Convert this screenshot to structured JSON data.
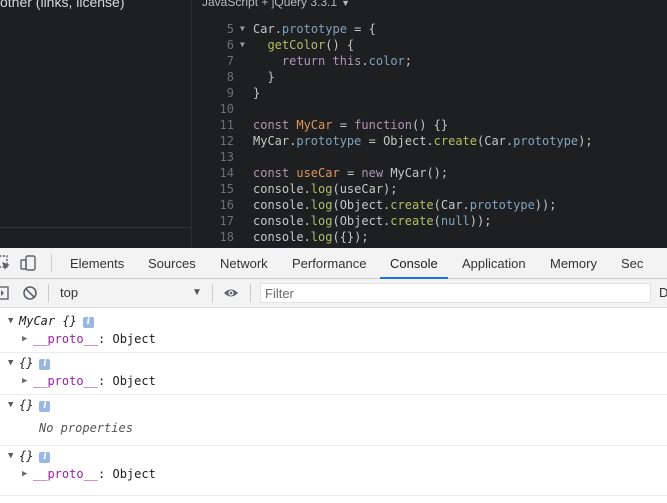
{
  "left_panel": {
    "text": "other (links, license)"
  },
  "editor": {
    "framework": "JavaScript + jQuery 3.3.1",
    "lines": [
      {
        "n": "5",
        "fold": true,
        "tokens": [
          {
            "t": "Car",
            "c": "p"
          },
          {
            "t": ".",
            "c": "p"
          },
          {
            "t": "prototype",
            "c": "prop"
          },
          {
            "t": " = {",
            "c": "p"
          }
        ]
      },
      {
        "n": "6",
        "fold": true,
        "tokens": [
          {
            "t": "  ",
            "c": "p"
          },
          {
            "t": "getColor",
            "c": "fn"
          },
          {
            "t": "() {",
            "c": "p"
          }
        ]
      },
      {
        "n": "7",
        "fold": false,
        "tokens": [
          {
            "t": "    ",
            "c": "p"
          },
          {
            "t": "return",
            "c": "kw"
          },
          {
            "t": " ",
            "c": "p"
          },
          {
            "t": "this",
            "c": "kw"
          },
          {
            "t": ".",
            "c": "p"
          },
          {
            "t": "color",
            "c": "prop"
          },
          {
            "t": ";",
            "c": "p"
          }
        ]
      },
      {
        "n": "8",
        "fold": false,
        "tokens": [
          {
            "t": "  }",
            "c": "p"
          }
        ]
      },
      {
        "n": "9",
        "fold": false,
        "tokens": [
          {
            "t": "}",
            "c": "p"
          }
        ]
      },
      {
        "n": "10",
        "fold": false,
        "tokens": []
      },
      {
        "n": "11",
        "fold": false,
        "tokens": [
          {
            "t": "const",
            "c": "kw"
          },
          {
            "t": " ",
            "c": "p"
          },
          {
            "t": "MyCar",
            "c": "var"
          },
          {
            "t": " = ",
            "c": "p"
          },
          {
            "t": "function",
            "c": "kw"
          },
          {
            "t": "() {}",
            "c": "p"
          }
        ]
      },
      {
        "n": "12",
        "fold": false,
        "tokens": [
          {
            "t": "MyCar.",
            "c": "p"
          },
          {
            "t": "prototype",
            "c": "prop"
          },
          {
            "t": " = Object.",
            "c": "p"
          },
          {
            "t": "create",
            "c": "fn"
          },
          {
            "t": "(Car.",
            "c": "p"
          },
          {
            "t": "prototype",
            "c": "prop"
          },
          {
            "t": ");",
            "c": "p"
          }
        ]
      },
      {
        "n": "13",
        "fold": false,
        "tokens": []
      },
      {
        "n": "14",
        "fold": false,
        "tokens": [
          {
            "t": "const",
            "c": "kw"
          },
          {
            "t": " ",
            "c": "p"
          },
          {
            "t": "useCar",
            "c": "var"
          },
          {
            "t": " = ",
            "c": "p"
          },
          {
            "t": "new",
            "c": "kw"
          },
          {
            "t": " MyCar();",
            "c": "p"
          }
        ]
      },
      {
        "n": "15",
        "fold": false,
        "tokens": [
          {
            "t": "console.",
            "c": "p"
          },
          {
            "t": "log",
            "c": "fn"
          },
          {
            "t": "(useCar);",
            "c": "p"
          }
        ]
      },
      {
        "n": "16",
        "fold": false,
        "tokens": [
          {
            "t": "console.",
            "c": "p"
          },
          {
            "t": "log",
            "c": "fn"
          },
          {
            "t": "(Object.",
            "c": "p"
          },
          {
            "t": "create",
            "c": "fn"
          },
          {
            "t": "(Car.",
            "c": "p"
          },
          {
            "t": "prototype",
            "c": "prop"
          },
          {
            "t": "));",
            "c": "p"
          }
        ]
      },
      {
        "n": "17",
        "fold": false,
        "tokens": [
          {
            "t": "console.",
            "c": "p"
          },
          {
            "t": "log",
            "c": "fn"
          },
          {
            "t": "(Object.",
            "c": "p"
          },
          {
            "t": "create",
            "c": "fn"
          },
          {
            "t": "(",
            "c": "p"
          },
          {
            "t": "null",
            "c": "prop"
          },
          {
            "t": "));",
            "c": "p"
          }
        ]
      },
      {
        "n": "18",
        "fold": false,
        "tokens": [
          {
            "t": "console.",
            "c": "p"
          },
          {
            "t": "log",
            "c": "fn"
          },
          {
            "t": "({});",
            "c": "p"
          }
        ]
      }
    ]
  },
  "devtools": {
    "tabs": [
      "Elements",
      "Sources",
      "Network",
      "Performance",
      "Console",
      "Application",
      "Memory",
      "Sec"
    ],
    "active_tab": "Console",
    "toolbar": {
      "context": "top",
      "filter_placeholder": "Filter",
      "levels_label": "D"
    },
    "console_entries": [
      {
        "header": "MyCar {}",
        "child_key": "__proto__",
        "child_value": ": Object"
      },
      {
        "header": "{}",
        "child_key": "__proto__",
        "child_value": ": Object"
      },
      {
        "header": "{}",
        "child_text": "No properties"
      },
      {
        "header": "{}",
        "child_key": "__proto__",
        "child_value": ": Object"
      }
    ],
    "info_glyph": "i"
  }
}
